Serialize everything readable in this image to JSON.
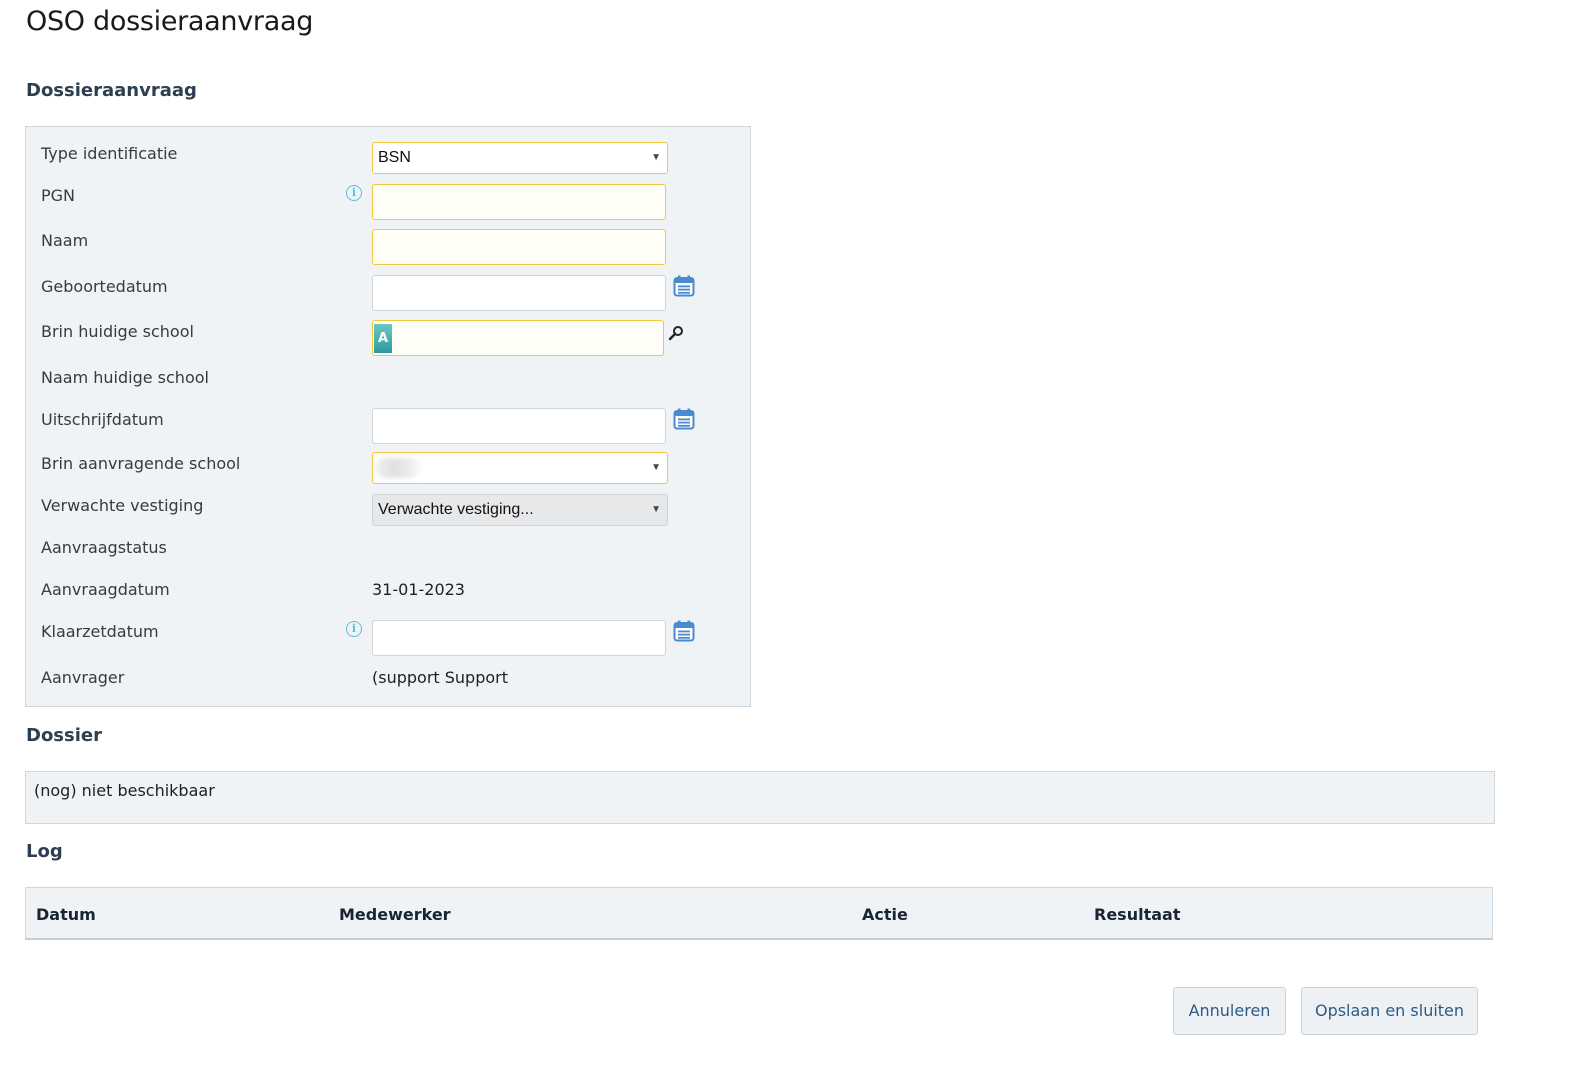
{
  "page": {
    "title": "OSO dossieraanvraag"
  },
  "sections": {
    "aanvraag": "Dossieraanvraag",
    "dossier": "Dossier",
    "log": "Log"
  },
  "form": {
    "type_identificatie": {
      "label": "Type identificatie",
      "value": "BSN"
    },
    "pgn": {
      "label": "PGN",
      "value": ""
    },
    "naam": {
      "label": "Naam",
      "value": ""
    },
    "geboortedatum": {
      "label": "Geboortedatum",
      "value": ""
    },
    "brin_huidige_school": {
      "label": "Brin huidige school",
      "value": "",
      "badge": "A"
    },
    "naam_huidige_school": {
      "label": "Naam huidige school",
      "value": ""
    },
    "uitschrijfdatum": {
      "label": "Uitschrijfdatum",
      "value": ""
    },
    "brin_aanvragende_school": {
      "label": "Brin aanvragende school",
      "value": ""
    },
    "verwachte_vestiging": {
      "label": "Verwachte vestiging",
      "value": "Verwachte vestiging..."
    },
    "aanvraagstatus": {
      "label": "Aanvraagstatus",
      "value": ""
    },
    "aanvraagdatum": {
      "label": "Aanvraagdatum",
      "value": "31-01-2023"
    },
    "klaarzetdatum": {
      "label": "Klaarzetdatum",
      "value": ""
    },
    "aanvrager": {
      "label": "Aanvrager",
      "value": "(support Support"
    }
  },
  "dossier": {
    "text": "(nog) niet beschikbaar"
  },
  "log": {
    "columns": [
      "Datum",
      "Medewerker",
      "Actie",
      "Resultaat"
    ]
  },
  "buttons": {
    "cancel": "Annuleren",
    "save_close": "Opslaan en sluiten"
  },
  "icons": {
    "select_arrow": "▼",
    "info": "i"
  },
  "colors": {
    "required_border": "#efc93c",
    "panel_bg": "#f0f3f6",
    "accent_blue": "#2a5b86",
    "calendar_blue": "#4a8bd0",
    "info_cyan": "#5bbfd8"
  }
}
